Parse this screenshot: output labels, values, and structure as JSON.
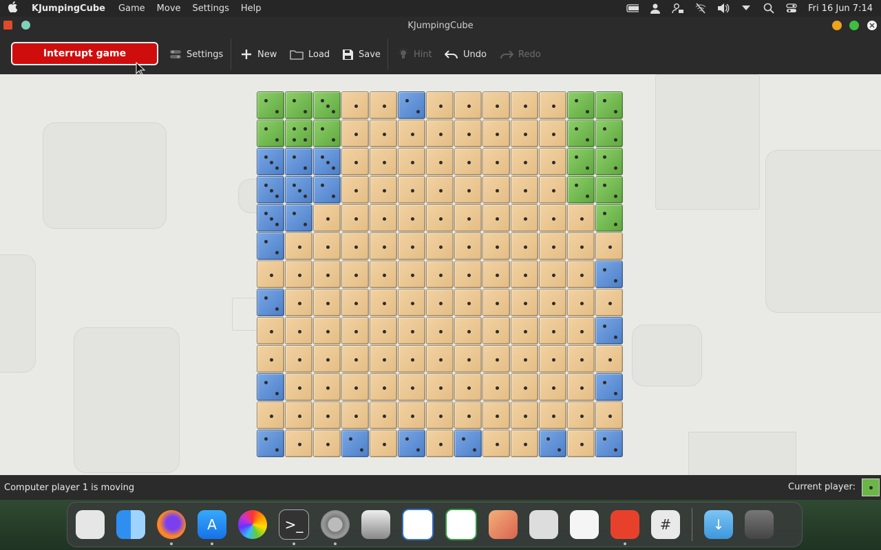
{
  "menubar": {
    "app_name": "KJumpingCube",
    "menus": [
      "Game",
      "Move",
      "Settings",
      "Help"
    ],
    "clock": "Fri 16 Jun  7:14",
    "status_icons": [
      "battery-icon",
      "user-icon",
      "user-lock-icon",
      "wifi-off-icon",
      "volume-icon",
      "dropdown-icon",
      "search-icon",
      "control-center-icon"
    ]
  },
  "window": {
    "title": "KJumpingCube"
  },
  "toolbar": {
    "interrupt_label": "Interrupt game",
    "settings_label": "Settings",
    "new_label": "New",
    "load_label": "Load",
    "save_label": "Save",
    "hint_label": "Hint",
    "undo_label": "Undo",
    "redo_label": "Redo"
  },
  "board": {
    "size": 13,
    "rows": [
      [
        "g2",
        "g2",
        "g3",
        "n1",
        "n1",
        "b2",
        "n1",
        "n1",
        "n1",
        "n1",
        "n1",
        "g2",
        "g2"
      ],
      [
        "g2",
        "g4",
        "g2",
        "n1",
        "n1",
        "n1",
        "n1",
        "n1",
        "n1",
        "n1",
        "n1",
        "g2",
        "g2"
      ],
      [
        "b3",
        "b2",
        "b3",
        "n1",
        "n1",
        "n1",
        "n1",
        "n1",
        "n1",
        "n1",
        "n1",
        "g2",
        "g2"
      ],
      [
        "b3",
        "b3",
        "b2",
        "n1",
        "n1",
        "n1",
        "n1",
        "n1",
        "n1",
        "n1",
        "n1",
        "g2",
        "g2"
      ],
      [
        "b3",
        "b2",
        "n1",
        "n1",
        "n1",
        "n1",
        "n1",
        "n1",
        "n1",
        "n1",
        "n1",
        "n1",
        "g2"
      ],
      [
        "b2",
        "n1",
        "n1",
        "n1",
        "n1",
        "n1",
        "n1",
        "n1",
        "n1",
        "n1",
        "n1",
        "n1",
        "n1"
      ],
      [
        "n1",
        "n1",
        "n1",
        "n1",
        "n1",
        "n1",
        "n1",
        "n1",
        "n1",
        "n1",
        "n1",
        "n1",
        "b2"
      ],
      [
        "b2",
        "n1",
        "n1",
        "n1",
        "n1",
        "n1",
        "n1",
        "n1",
        "n1",
        "n1",
        "n1",
        "n1",
        "n1"
      ],
      [
        "n1",
        "n1",
        "n1",
        "n1",
        "n1",
        "n1",
        "n1",
        "n1",
        "n1",
        "n1",
        "n1",
        "n1",
        "b2"
      ],
      [
        "n1",
        "n1",
        "n1",
        "n1",
        "n1",
        "n1",
        "n1",
        "n1",
        "n1",
        "n1",
        "n1",
        "n1",
        "n1"
      ],
      [
        "b2",
        "n1",
        "n1",
        "n1",
        "n1",
        "n1",
        "n1",
        "n1",
        "n1",
        "n1",
        "n1",
        "n1",
        "b2"
      ],
      [
        "n1",
        "n1",
        "n1",
        "n1",
        "n1",
        "n1",
        "n1",
        "n1",
        "n1",
        "n1",
        "n1",
        "n1",
        "n1"
      ],
      [
        "b2",
        "n1",
        "n1",
        "b2",
        "n1",
        "b2",
        "n1",
        "b2",
        "n1",
        "n1",
        "b2",
        "n1",
        "b2"
      ]
    ],
    "colors": {
      "neutral": "#ebc690",
      "green": "#6cb648",
      "blue": "#5f8fd6"
    }
  },
  "status": {
    "message": "Computer player 1 is moving",
    "current_player_label": "Current player:",
    "current_player_color": "#6cb648"
  },
  "dock": {
    "apps": [
      {
        "name": "launchpad-icon",
        "running": false
      },
      {
        "name": "finder-icon",
        "running": false
      },
      {
        "name": "firefox-icon",
        "running": true
      },
      {
        "name": "app-store-icon",
        "running": true
      },
      {
        "name": "photos-icon",
        "running": false
      },
      {
        "name": "terminal-icon",
        "running": true
      },
      {
        "name": "system-settings-icon",
        "running": true
      },
      {
        "name": "screenshot-icon",
        "running": false
      },
      {
        "name": "writer-icon",
        "running": false
      },
      {
        "name": "spreadsheet-icon",
        "running": false
      },
      {
        "name": "draw-icon",
        "running": false
      },
      {
        "name": "media-player-icon",
        "running": false
      },
      {
        "name": "text-editor-icon",
        "running": false
      },
      {
        "name": "kjumpingcube-icon",
        "running": true
      },
      {
        "name": "calculator-icon",
        "running": false
      }
    ],
    "right": [
      {
        "name": "downloads-folder-icon"
      },
      {
        "name": "trash-icon"
      }
    ]
  }
}
